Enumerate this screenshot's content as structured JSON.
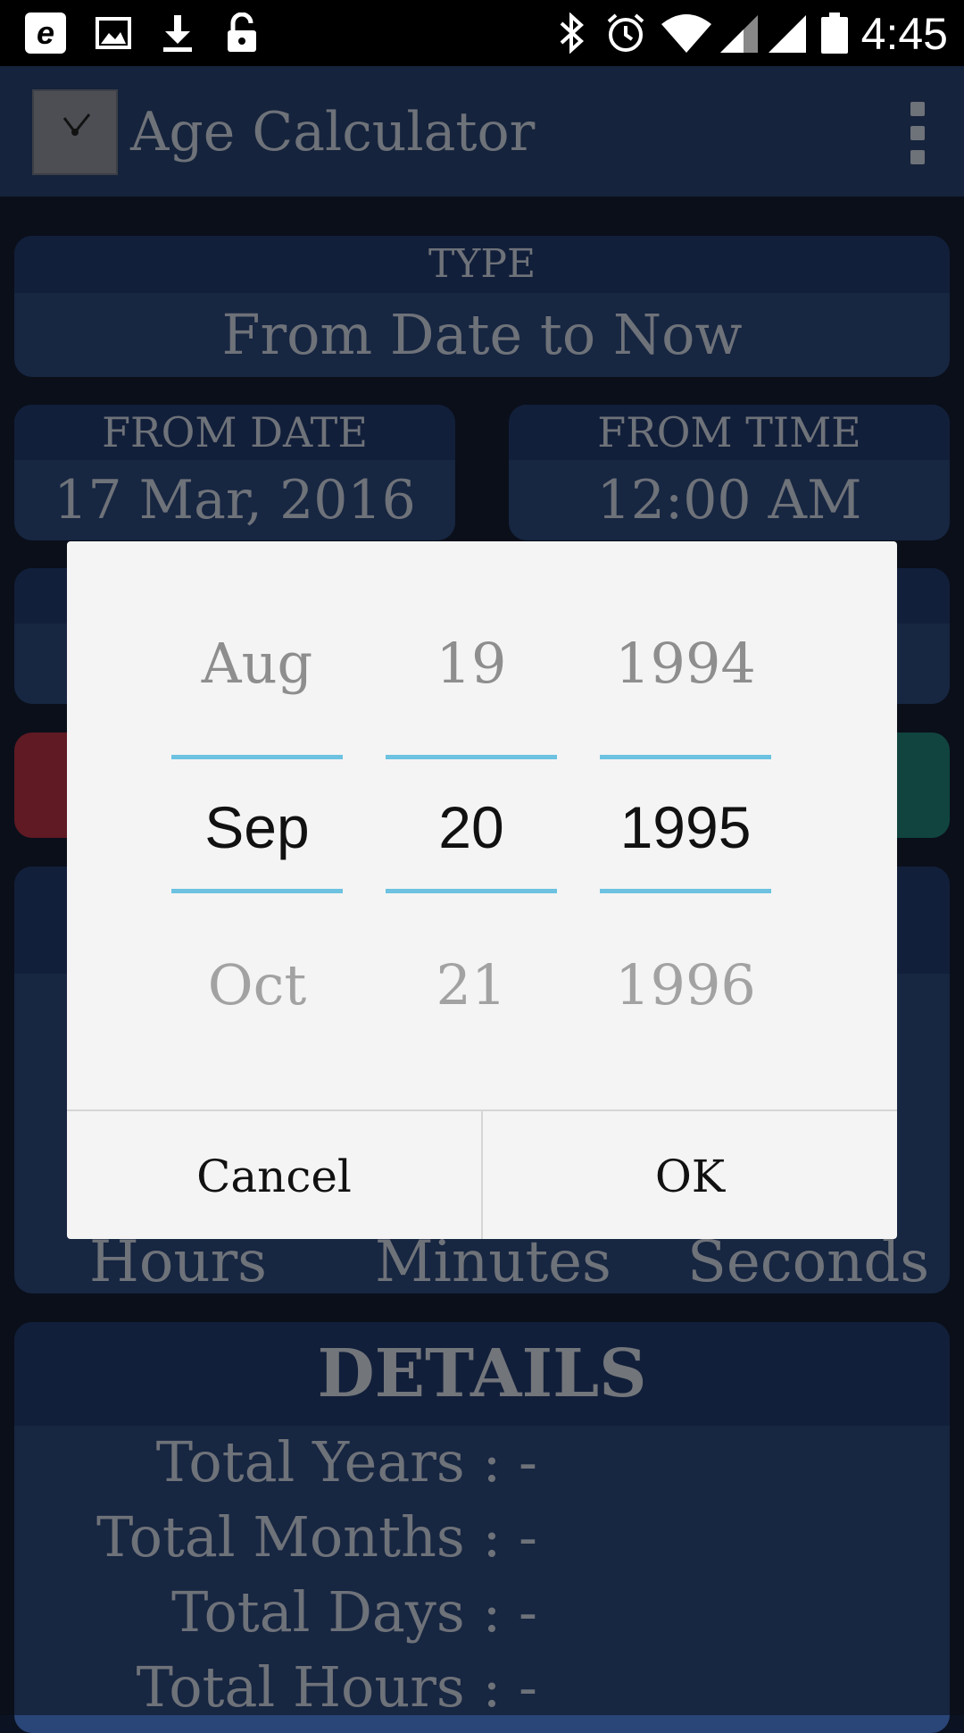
{
  "status_bar": {
    "time": "4:45",
    "icons": [
      "e-notification-icon",
      "image-icon",
      "download-icon",
      "unlock-icon",
      "bluetooth-icon",
      "alarm-icon",
      "wifi-icon",
      "signal-icon",
      "signal-icon",
      "battery-icon"
    ],
    "e_glyph": "e"
  },
  "app_bar": {
    "title": "Age Calculator"
  },
  "type_card": {
    "label": "TYPE",
    "value": "From Date to Now"
  },
  "from_date_card": {
    "label": "FROM DATE",
    "value": "17 Mar, 2016"
  },
  "from_time_card": {
    "label": "FROM TIME",
    "value": "12:00 AM"
  },
  "units_row": {
    "hours": "Hours",
    "minutes": "Minutes",
    "seconds": "Seconds"
  },
  "details": {
    "title": "DETAILS",
    "lines": [
      "Total Years : -",
      "Total Months : -",
      "Total Days : -",
      "Total Hours : -"
    ]
  },
  "date_picker": {
    "month": {
      "prev": "Aug",
      "current": "Sep",
      "next": "Oct"
    },
    "day": {
      "prev": "19",
      "current": "20",
      "next": "21"
    },
    "year": {
      "prev": "1994",
      "current": "1995",
      "next": "1996"
    },
    "cancel_label": "Cancel",
    "ok_label": "OK",
    "accent_color": "#6cc2e0"
  }
}
